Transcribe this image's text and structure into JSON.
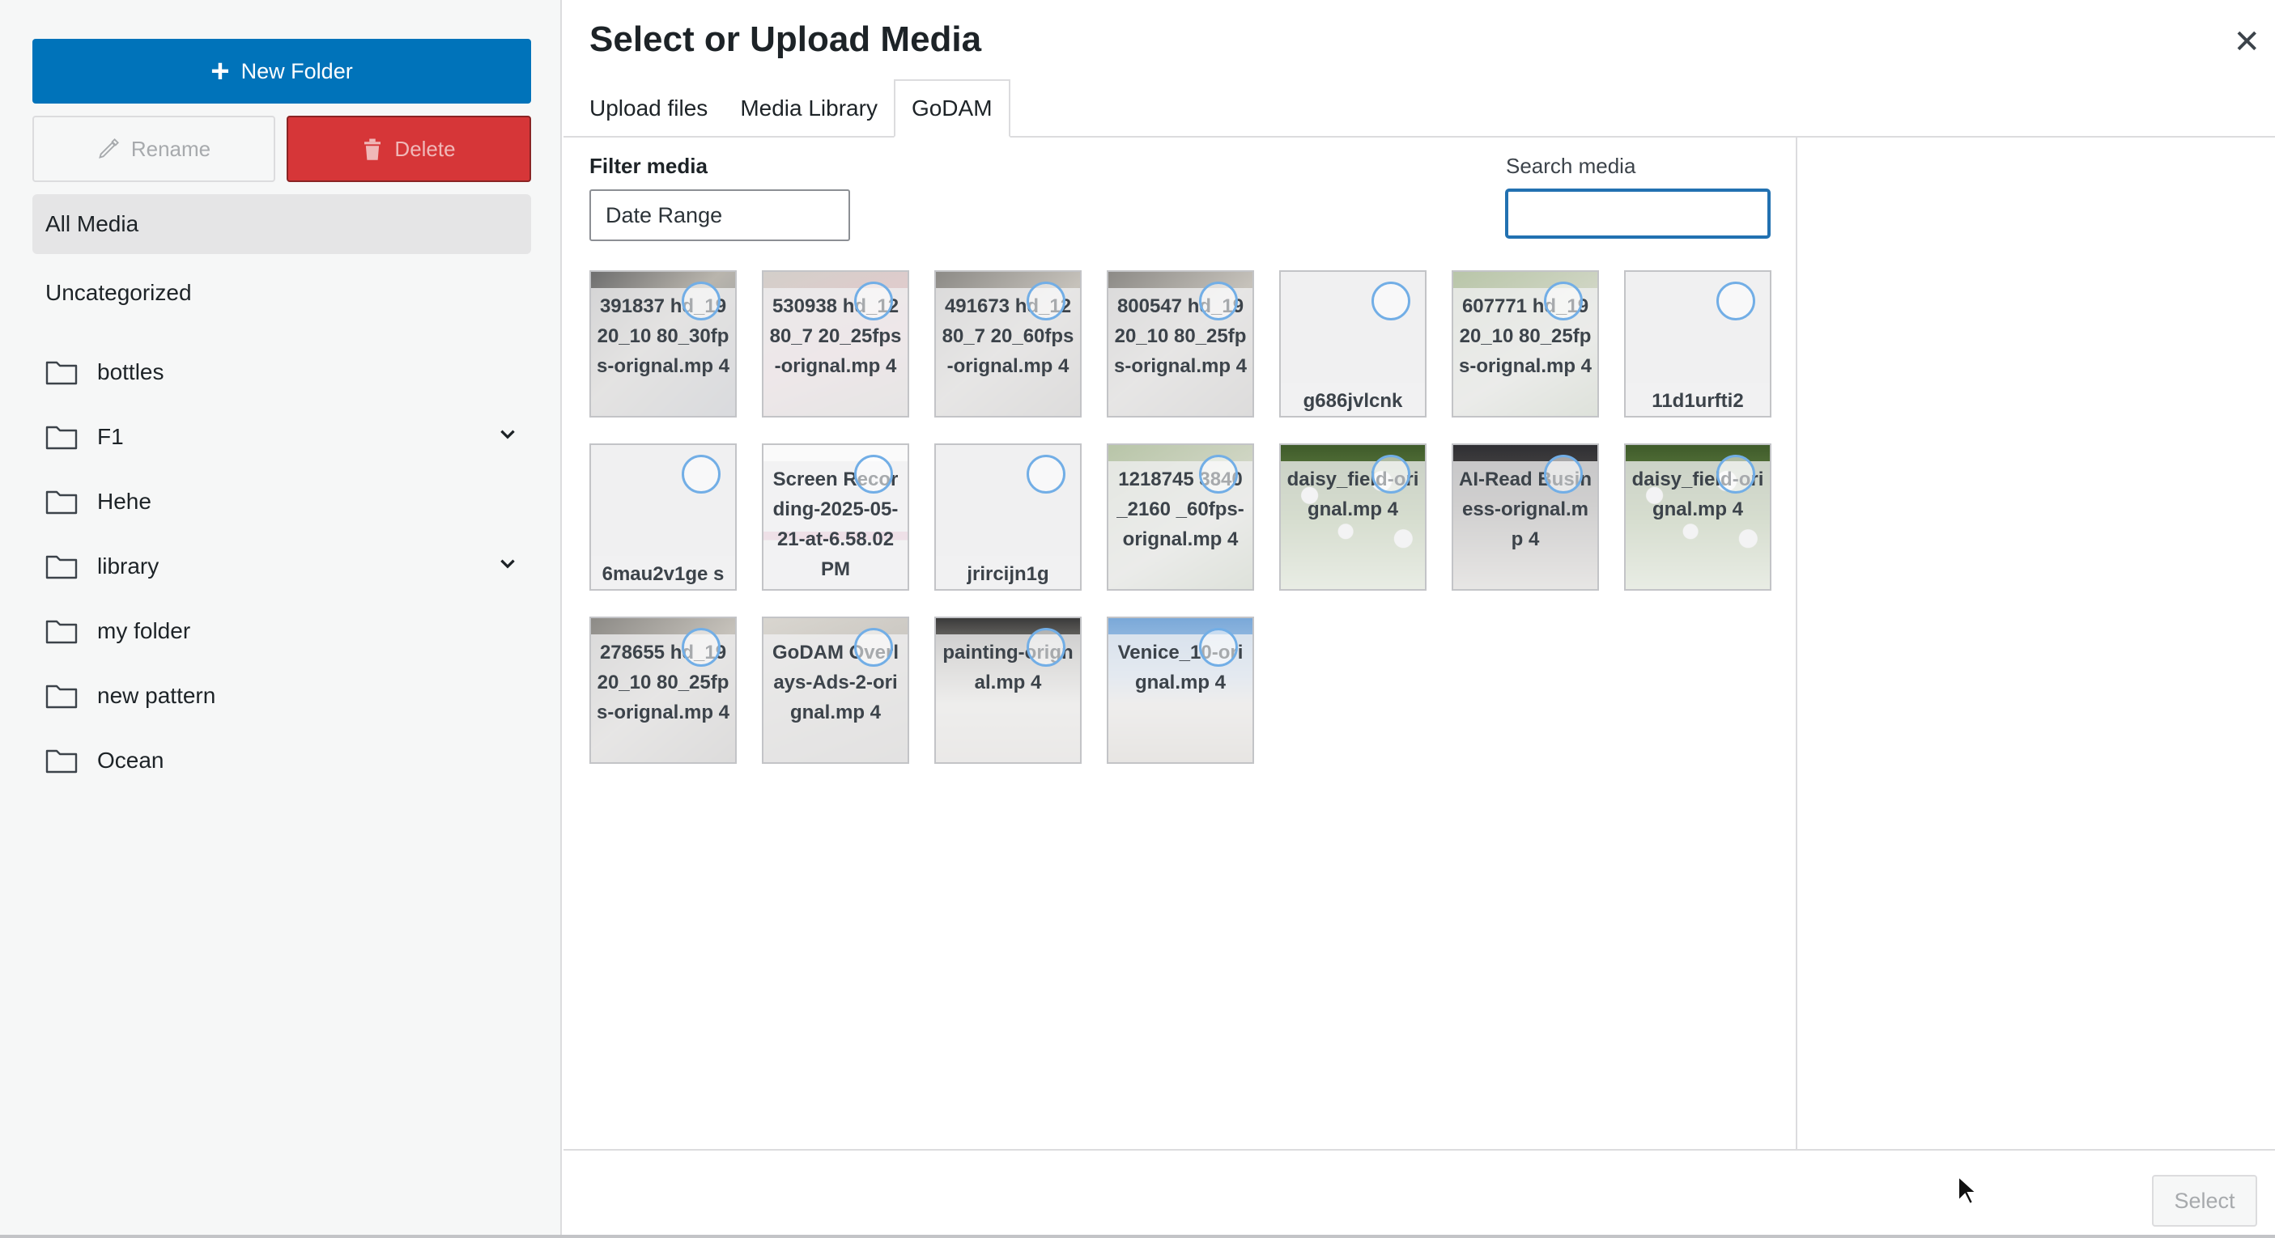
{
  "sidebar": {
    "new_folder_label": "New Folder",
    "rename_label": "Rename",
    "delete_label": "Delete",
    "all_media_label": "All Media",
    "uncategorized_label": "Uncategorized",
    "folders": [
      {
        "label": "bottles",
        "expandable": false
      },
      {
        "label": "F1",
        "expandable": true
      },
      {
        "label": "Hehe",
        "expandable": false
      },
      {
        "label": "library",
        "expandable": true
      },
      {
        "label": "my folder",
        "expandable": false
      },
      {
        "label": "new pattern",
        "expandable": false
      },
      {
        "label": "Ocean",
        "expandable": false
      }
    ]
  },
  "modal": {
    "title": "Select or Upload Media",
    "close_icon": "close-icon",
    "tabs": [
      {
        "label": "Upload files",
        "active": false
      },
      {
        "label": "Media Library",
        "active": false
      },
      {
        "label": "GoDAM",
        "active": true
      }
    ]
  },
  "filters": {
    "filter_label": "Filter media",
    "date_range_value": "Date Range",
    "search_label": "Search media",
    "search_value": ""
  },
  "media_items": [
    {
      "name": "391837 hd_1920_10 80_30fps-orignal.mp 4",
      "thumb": "road"
    },
    {
      "name": "530938 hd_1280_7 20_25fps-orignal.mp 4",
      "thumb": "pink"
    },
    {
      "name": "491673 hd_1280_7 20_60fps-orignal.mp 4",
      "thumb": "grey"
    },
    {
      "name": "800547 hd_1920_10 80_25fps-orignal.mp 4",
      "thumb": "grey"
    },
    {
      "name": "g686jvlcnk",
      "thumb": "blank"
    },
    {
      "name": "607771 hd_1920_10 80_25fps-orignal.mp 4",
      "thumb": "green"
    },
    {
      "name": "11d1urfti2",
      "thumb": "blank"
    },
    {
      "name": "6mau2v1ge s",
      "thumb": "blank"
    },
    {
      "name": "Screen Recording-2025-05-21-at-6.58.02 PM",
      "thumb": "screen"
    },
    {
      "name": "jrircijn1g",
      "thumb": "blank"
    },
    {
      "name": "1218745 3840_2160 _60fps-orignal.mp 4",
      "thumb": "green"
    },
    {
      "name": "daisy_field-orignal.mp 4",
      "thumb": "daisy"
    },
    {
      "name": "AI-Read Business-orignal.mp 4",
      "thumb": "dark"
    },
    {
      "name": "daisy_field-orignal.mp 4",
      "thumb": "daisy"
    },
    {
      "name": "278655 hd_1920_10 80_25fps-orignal.mp 4",
      "thumb": "grey"
    },
    {
      "name": "GoDAM Overlays-Ads-2-orignal.mp 4",
      "thumb": "overlay"
    },
    {
      "name": "painting-orignal.mp 4",
      "thumb": "paint"
    },
    {
      "name": "Venice_10-orignal.mp 4",
      "thumb": "venice"
    }
  ],
  "footer": {
    "select_label": "Select"
  },
  "colors": {
    "primary": "#0073ba",
    "danger": "#d63638",
    "focus": "#2271b1"
  }
}
